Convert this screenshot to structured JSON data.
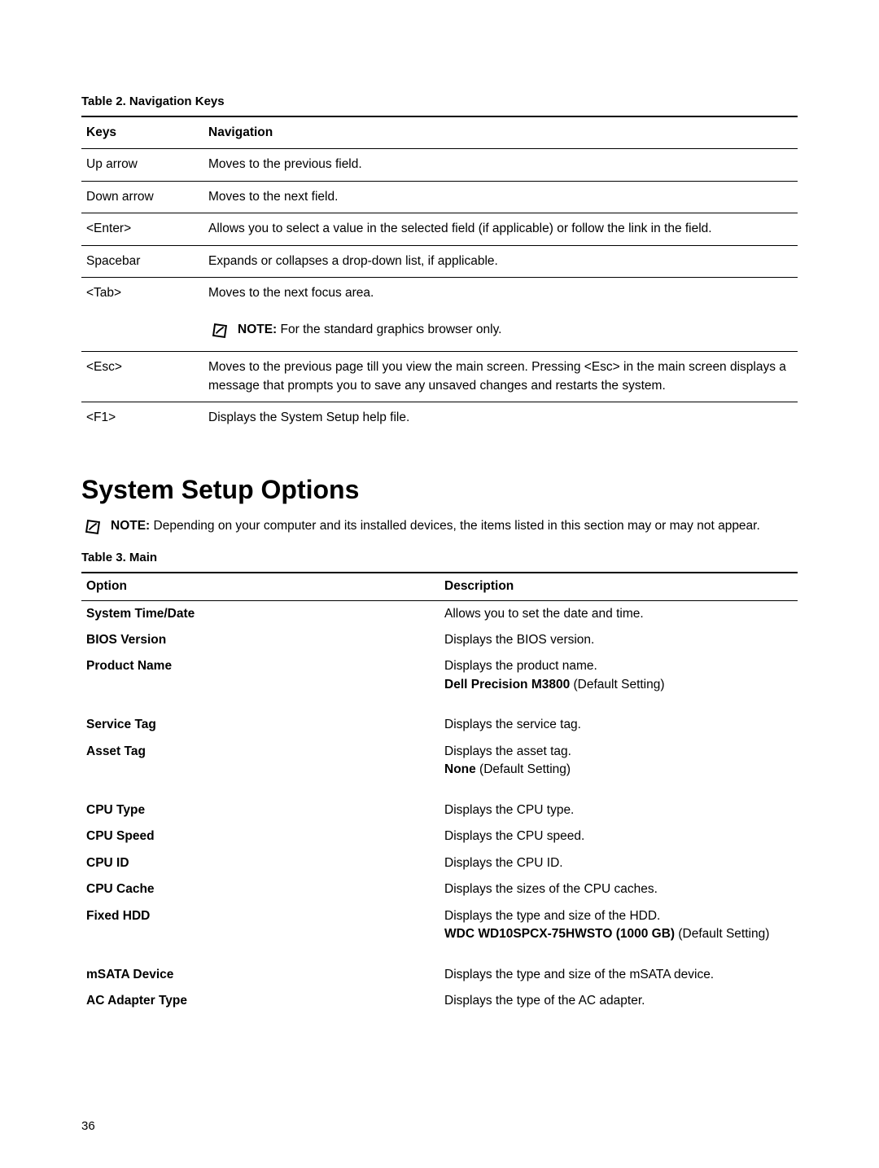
{
  "table2": {
    "caption": "Table 2. Navigation Keys",
    "head_keys": "Keys",
    "head_nav": "Navigation",
    "rows": {
      "up": {
        "k": "Up arrow",
        "d": "Moves to the previous field."
      },
      "down": {
        "k": "Down arrow",
        "d": "Moves to the next field."
      },
      "enter": {
        "k": "<Enter>",
        "d": "Allows you to select a value in the selected field (if applicable) or follow the link in the field."
      },
      "space": {
        "k": "Spacebar",
        "d": "Expands or collapses a drop-down list, if applicable."
      },
      "tab": {
        "k": "<Tab>",
        "d": "Moves to the next focus area."
      },
      "tab_note_label": "NOTE:",
      "tab_note": "For the standard graphics browser only.",
      "esc": {
        "k": "<Esc>",
        "d": "Moves to the previous page till you view the main screen. Pressing <Esc> in the main screen displays a message that prompts you to save any unsaved changes and restarts the system."
      },
      "f1": {
        "k": "<F1>",
        "d": "Displays the System Setup help file."
      }
    }
  },
  "sso_heading": "System Setup Options",
  "sso_note_label": "NOTE:",
  "sso_note": "Depending on your computer and its installed devices, the items listed in this section may or may not appear.",
  "table3": {
    "caption": "Table 3. Main",
    "head_opt": "Option",
    "head_desc": "Description",
    "rows": {
      "sysdate": {
        "o": "System Time/Date",
        "d1": "Allows you to set the date and time."
      },
      "biosver": {
        "o": "BIOS Version",
        "d1": "Displays the BIOS version."
      },
      "prodname": {
        "o": "Product Name",
        "d1": "Displays the product name.",
        "d2b": "Dell Precision M3800",
        "d2t": " (Default Setting)"
      },
      "svctag": {
        "o": "Service Tag",
        "d1": "Displays the service tag."
      },
      "assettag": {
        "o": "Asset Tag",
        "d1": "Displays the asset tag.",
        "d2b": "None",
        "d2t": " (Default Setting)"
      },
      "cputype": {
        "o": "CPU Type",
        "d1": "Displays the CPU type."
      },
      "cpuspeed": {
        "o": "CPU Speed",
        "d1": "Displays the CPU speed."
      },
      "cpuid": {
        "o": "CPU ID",
        "d1": "Displays the CPU ID."
      },
      "cpucache": {
        "o": "CPU Cache",
        "d1": "Displays the sizes of the CPU caches."
      },
      "fixedhdd": {
        "o": "Fixed HDD",
        "d1": "Displays the type and size of the HDD.",
        "d2b": "WDC WD10SPCX-75HWSTO (1000 GB)",
        "d2t": " (Default Setting)"
      },
      "msata": {
        "o": "mSATA Device",
        "d1": "Displays the type and size of the mSATA device."
      },
      "acadpt": {
        "o": "AC Adapter Type",
        "d1": "Displays the type of the AC adapter."
      }
    }
  },
  "page_number": "36"
}
